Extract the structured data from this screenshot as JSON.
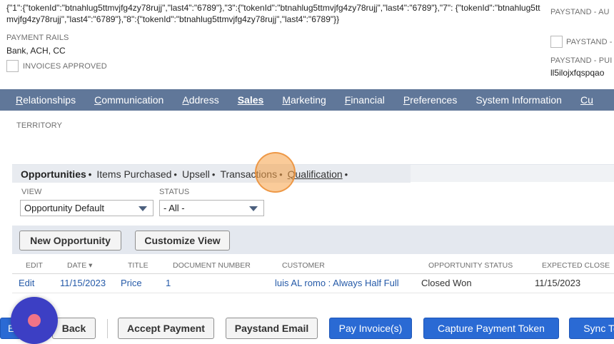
{
  "top": {
    "json_text": "{\"1\":{\"tokenId\":\"btnahlug5ttmvjfg4zy78rujj\",\"last4\":\"6789\"},\"3\":{\"tokenId\":\"btnahlug5ttmvjfg4zy78rujj\",\"last4\":\"6789\"},\"7\": {\"tokenId\":\"btnahlug5ttmvjfg4zy78rujj\",\"last4\":\"6789\"},\"8\":{\"tokenId\":\"btnahlug5ttmvjfg4zy78rujj\",\"last4\":\"6789\"}}",
    "payment_rails_label": "PAYMENT RAILS",
    "payment_rails_value": "Bank, ACH, CC",
    "invoices_approved_label": "INVOICES APPROVED"
  },
  "right_column": {
    "field1_label": "PAYSTAND - AU",
    "field2_label": "PAYSTAND -",
    "field3_label": "PAYSTAND - PUI",
    "field3_value": "ll5ilojxfqspqao"
  },
  "main_tabs": [
    {
      "label": "Relationships",
      "underline": "R",
      "rest": "elationships"
    },
    {
      "label": "Communication",
      "underline": "C",
      "rest": "ommunication"
    },
    {
      "label": "Address",
      "underline": "A",
      "rest": "ddress"
    },
    {
      "label": "Sales",
      "underline": "",
      "rest": "Sales"
    },
    {
      "label": "Marketing",
      "underline": "M",
      "rest": "arketing"
    },
    {
      "label": "Financial",
      "underline": "F",
      "rest": "inancial"
    },
    {
      "label": "Preferences",
      "underline": "P",
      "rest": "references"
    },
    {
      "label": "System Information",
      "underline": "",
      "rest": "System Information"
    },
    {
      "label": "Cu",
      "underline": "",
      "rest": "Cu"
    }
  ],
  "territory_label": "TERRITORY",
  "subtabs": {
    "opportunities": "Opportunities",
    "items_purchased": "Items Purchased",
    "upsell": "Upsell",
    "transactions": "Transactions",
    "qualification": "Qualification",
    "dot": "•"
  },
  "filters": {
    "view_label": "VIEW",
    "view_value": "Opportunity Default",
    "status_label": "STATUS",
    "status_value": "- All -"
  },
  "list_buttons": {
    "new_opportunity": "New Opportunity",
    "customize_view": "Customize View"
  },
  "table": {
    "headers": [
      "EDIT",
      "DATE ▾",
      "TITLE",
      "DOCUMENT NUMBER",
      "CUSTOMER",
      "OPPORTUNITY STATUS",
      "EXPECTED CLOSE"
    ],
    "rows": [
      {
        "edit": "Edit",
        "date": "11/15/2023",
        "title": "Price",
        "doc_number": "1",
        "customer": "luis AL romo : Always Half Full",
        "status": "Closed Won",
        "expected_close": "11/15/2023"
      }
    ]
  },
  "bottom_buttons": {
    "edit": "E",
    "back": "Back",
    "accept_payment": "Accept Payment",
    "paystand_email": "Paystand Email",
    "pay_invoices": "Pay Invoice(s)",
    "capture_token": "Capture Payment Token",
    "sync": "Sync To"
  },
  "colors": {
    "tab_bar": "#607799",
    "primary_button": "#2a6ad4",
    "link": "#255aa8",
    "record_button": "#3c3fc4"
  }
}
